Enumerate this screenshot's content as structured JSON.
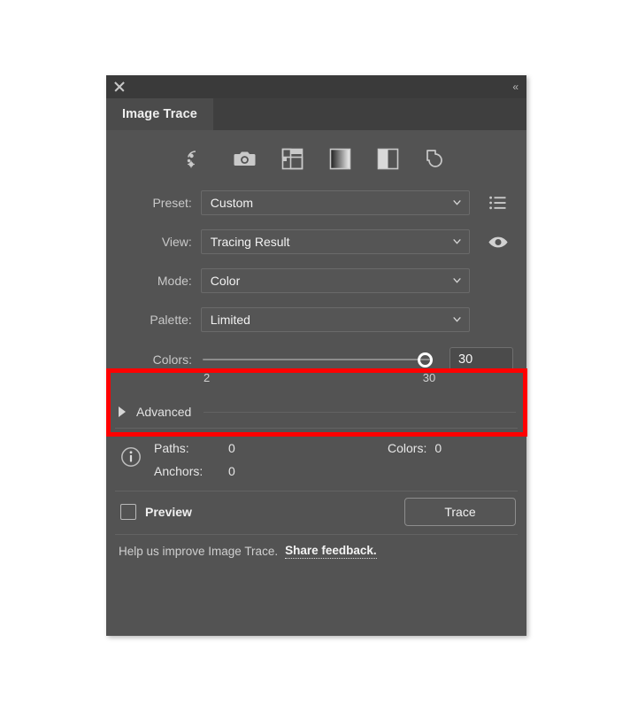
{
  "panel": {
    "title_tab": "Image Trace",
    "close_icon": "close-icon",
    "collapse_icon": "«"
  },
  "preset_icons": [
    {
      "name": "auto-color-icon",
      "title": "Auto-Color"
    },
    {
      "name": "high-color-icon",
      "title": "High Color"
    },
    {
      "name": "low-color-icon",
      "title": "Low Color"
    },
    {
      "name": "grayscale-icon",
      "title": "Grayscale"
    },
    {
      "name": "black-and-white-icon",
      "title": "Black and White"
    },
    {
      "name": "outline-icon",
      "title": "Outline"
    }
  ],
  "fields": {
    "preset": {
      "label": "Preset:",
      "value": "Custom",
      "side_icon": "list-menu-icon"
    },
    "view": {
      "label": "View:",
      "value": "Tracing Result",
      "side_icon": "eye-icon"
    },
    "mode": {
      "label": "Mode:",
      "value": "Color"
    },
    "palette": {
      "label": "Palette:",
      "value": "Limited"
    }
  },
  "colors_slider": {
    "label": "Colors:",
    "value": "30",
    "min_label": "2",
    "max_label": "30",
    "min": 2,
    "max": 30,
    "current": 30,
    "thumb_percent": 100,
    "highlight_color": "#ff0000"
  },
  "advanced": {
    "label": "Advanced",
    "expanded": false,
    "triangle_icon": "triangle-right-icon"
  },
  "info": {
    "icon": "info-circle-icon",
    "paths_label": "Paths:",
    "paths_value": "0",
    "colors_label": "Colors:",
    "colors_value": "0",
    "anchors_label": "Anchors:",
    "anchors_value": "0"
  },
  "actions": {
    "preview_label": "Preview",
    "preview_checked": false,
    "trace_label": "Trace"
  },
  "footer": {
    "text": "Help us improve Image Trace.",
    "link": "Share feedback."
  }
}
